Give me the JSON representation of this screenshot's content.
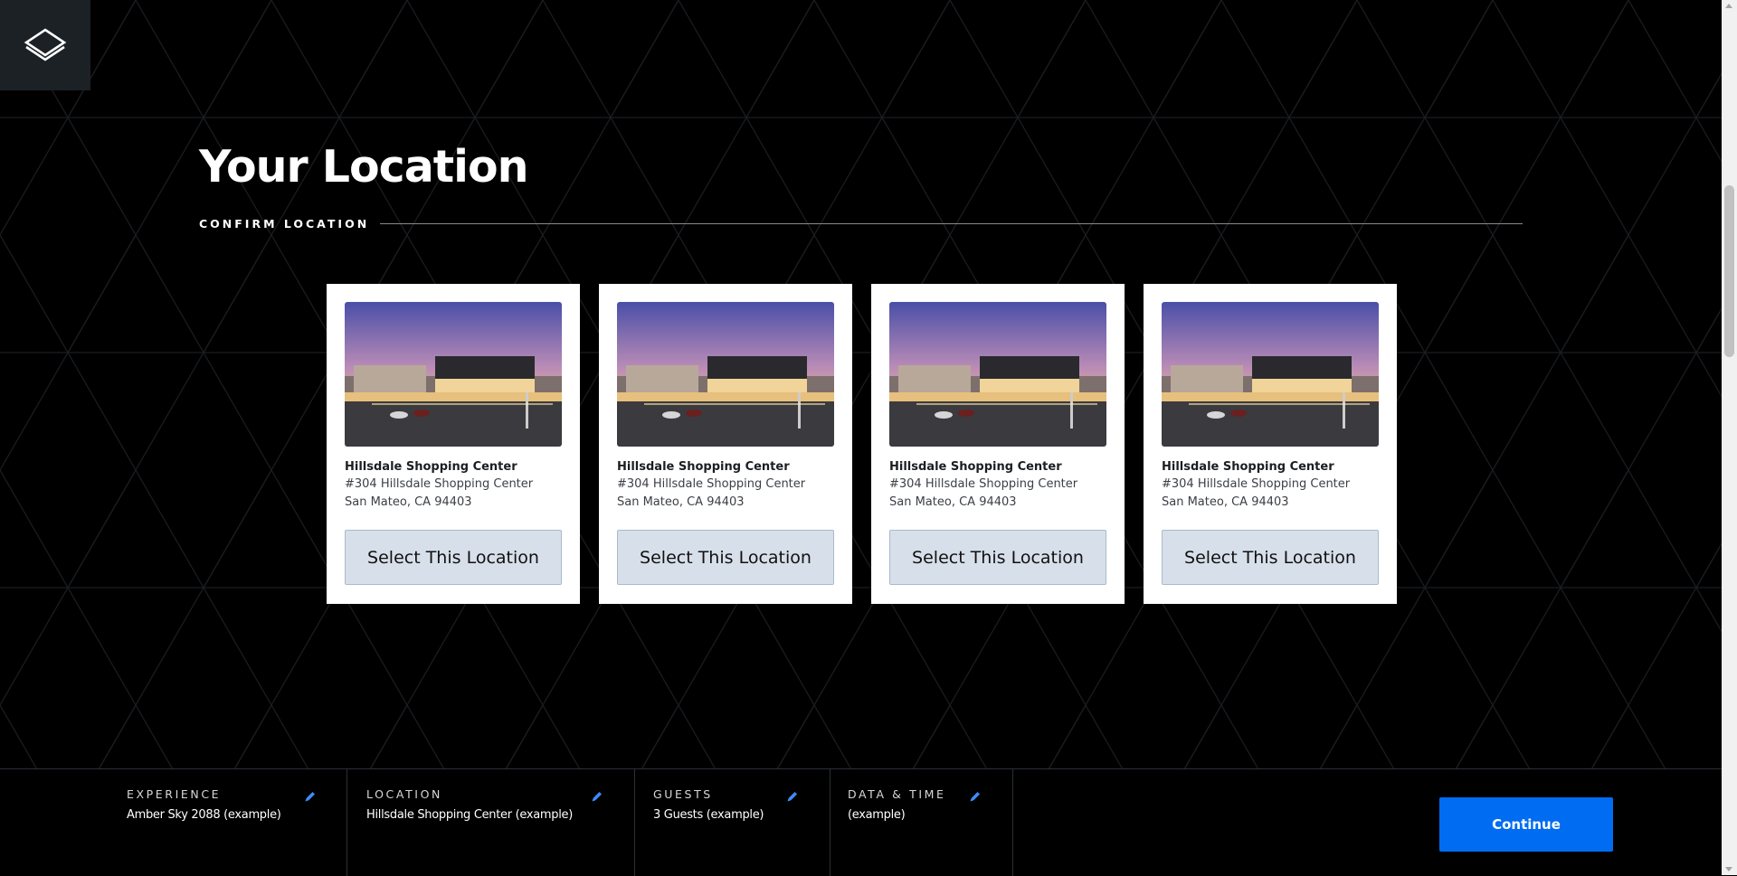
{
  "logo": {
    "icon": "diamond-logo-icon"
  },
  "page": {
    "title": "Your Location",
    "section_label": "CONFIRM LOCATION"
  },
  "locations": [
    {
      "name": "Hillsdale Shopping Center",
      "address_line1": "#304 Hillsdale Shopping Center",
      "address_line2": "San Mateo, CA 94403",
      "button_label": "Select This Location"
    },
    {
      "name": "Hillsdale Shopping Center",
      "address_line1": "#304 Hillsdale Shopping Center",
      "address_line2": "San Mateo, CA 94403",
      "button_label": "Select This Location"
    },
    {
      "name": "Hillsdale Shopping Center",
      "address_line1": "#304 Hillsdale Shopping Center",
      "address_line2": "San Mateo, CA 94403",
      "button_label": "Select This Location"
    },
    {
      "name": "Hillsdale Shopping Center",
      "address_line1": "#304 Hillsdale Shopping Center",
      "address_line2": "San Mateo, CA 94403",
      "button_label": "Select This Location"
    }
  ],
  "summary": {
    "experience": {
      "label": "EXPERIENCE",
      "value": "Amber Sky 2088 (example)",
      "edit_icon": "pencil-icon"
    },
    "location": {
      "label": "LOCATION",
      "value": "Hillsdale Shopping Center (example)",
      "edit_icon": "pencil-icon"
    },
    "guests": {
      "label": "GUESTS",
      "value": "3 Guests (example)",
      "edit_icon": "pencil-icon"
    },
    "datetime": {
      "label": "DATA & TIME",
      "value": "(example)",
      "edit_icon": "pencil-icon"
    },
    "continue_label": "Continue"
  },
  "colors": {
    "background": "#000000",
    "accent": "#006cf2",
    "select_button": "#d7e0ea",
    "edit_icon": "#3d8bff"
  }
}
